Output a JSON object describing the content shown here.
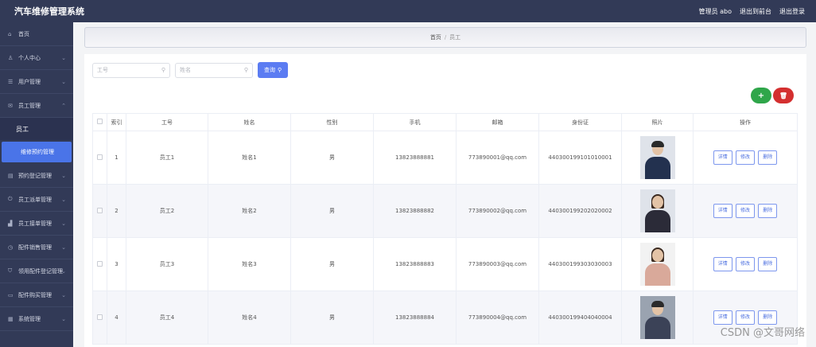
{
  "header": {
    "app_title": "汽车维修管理系统",
    "user": "管理员 abo",
    "frontend_link": "退出到前台",
    "logout_link": "退出登录"
  },
  "sidebar": {
    "items": [
      {
        "label": "首页",
        "icon": "home-icon"
      },
      {
        "label": "个人中心",
        "icon": "user-icon"
      },
      {
        "label": "用户管理",
        "icon": "list-icon"
      },
      {
        "label": "员工管理",
        "icon": "mail-icon"
      }
    ],
    "sub_items": [
      {
        "label": "员工"
      },
      {
        "label": "维修预约管理"
      }
    ],
    "items_after": [
      {
        "label": "预约登记管理",
        "icon": "document-icon"
      },
      {
        "label": "员工派单管理",
        "icon": "power-icon"
      },
      {
        "label": "员工接单管理",
        "icon": "chart-icon"
      },
      {
        "label": "配件销售管理",
        "icon": "clock-icon"
      },
      {
        "label": "领用配件登记管理",
        "icon": "filter-icon"
      },
      {
        "label": "配件购买管理",
        "icon": "cart-icon"
      },
      {
        "label": "系统管理",
        "icon": "settings-icon"
      }
    ]
  },
  "breadcrumb": {
    "home": "首页",
    "separator": "/",
    "current": "员工"
  },
  "search": {
    "employee_no_placeholder": "工号",
    "name_placeholder": "姓名",
    "query_label": "查询"
  },
  "actions": {
    "add": "+",
    "delete": "🗑"
  },
  "table": {
    "columns": [
      "",
      "索引",
      "工号",
      "姓名",
      "性别",
      "手机",
      "邮箱",
      "身份证",
      "照片",
      "操作"
    ],
    "rows": [
      {
        "index": "1",
        "no": "员工1",
        "name": "姓名1",
        "gender": "男",
        "phone": "13823888881",
        "email": "773890001@qq.com",
        "id_card": "440300199101010001"
      },
      {
        "index": "2",
        "no": "员工2",
        "name": "姓名2",
        "gender": "男",
        "phone": "13823888882",
        "email": "773890002@qq.com",
        "id_card": "440300199202020002"
      },
      {
        "index": "3",
        "no": "员工3",
        "name": "姓名3",
        "gender": "男",
        "phone": "13823888883",
        "email": "773890003@qq.com",
        "id_card": "440300199303030003"
      },
      {
        "index": "4",
        "no": "员工4",
        "name": "姓名4",
        "gender": "男",
        "phone": "13823888884",
        "email": "773890004@qq.com",
        "id_card": "440300199404040004"
      }
    ],
    "op_detail": "详情",
    "op_edit": "修改",
    "op_delete": "删除"
  },
  "watermark": "CSDN @文哥网络"
}
